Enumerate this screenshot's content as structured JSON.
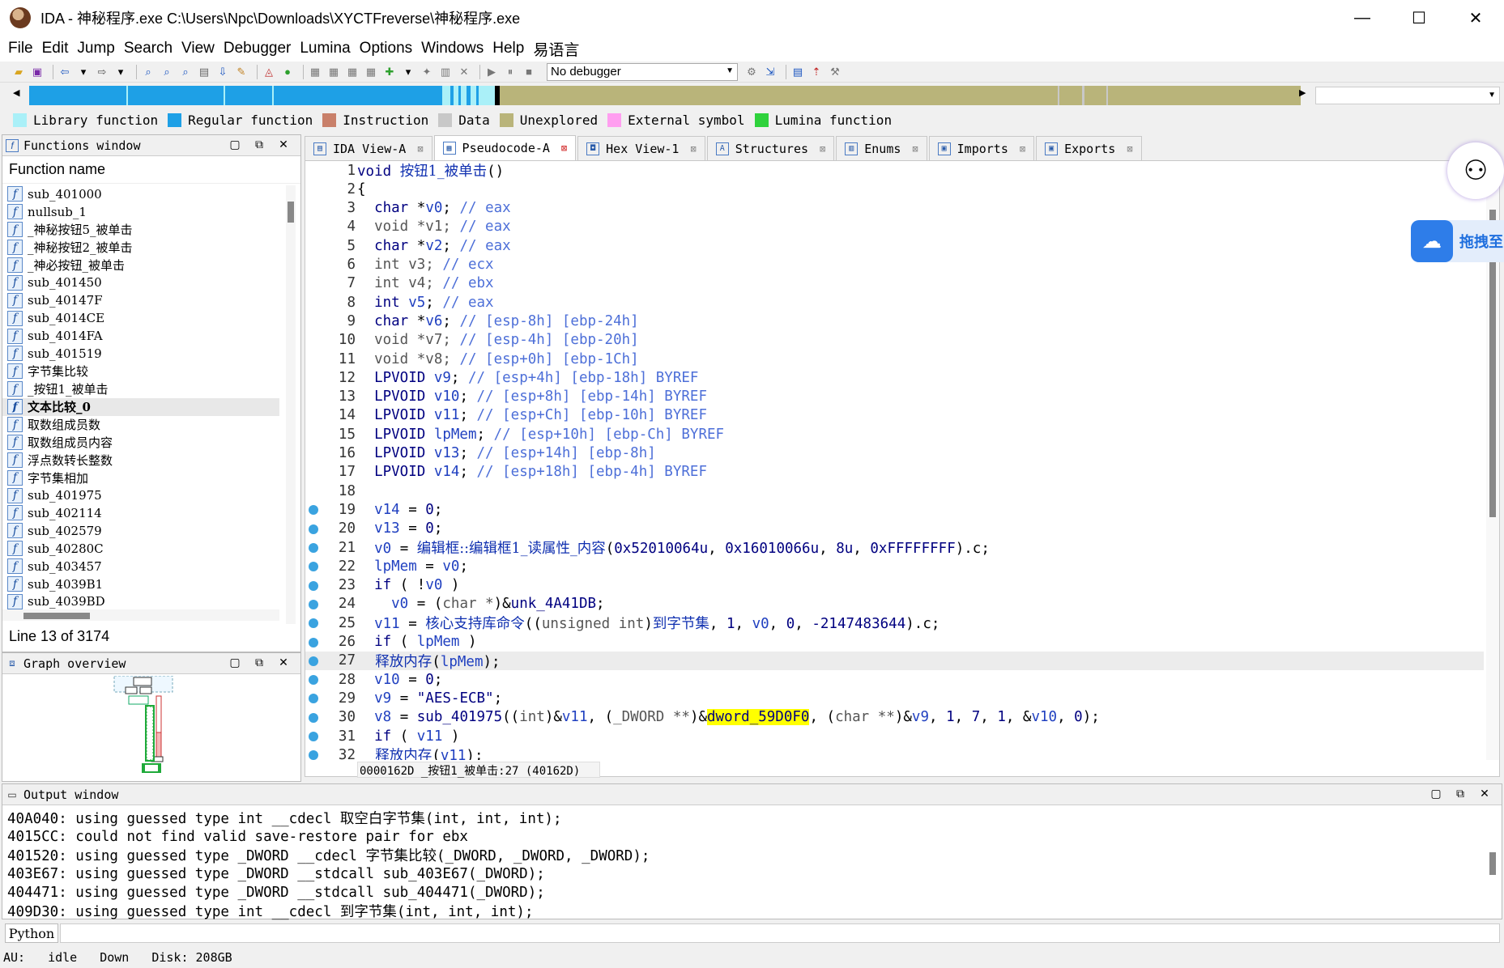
{
  "window": {
    "title": "IDA - 神秘程序.exe C:\\Users\\Npc\\Downloads\\XYCTFreverse\\神秘程序.exe",
    "minimize": "—",
    "maximize": "☐",
    "close": "✕"
  },
  "menu": [
    "File",
    "Edit",
    "Jump",
    "Search",
    "View",
    "Debugger",
    "Lumina",
    "Options",
    "Windows",
    "Help",
    "易语言"
  ],
  "toolbar": {
    "debugger_select": "No debugger"
  },
  "legend": [
    {
      "label": "Library function",
      "color": "#aaf0f8"
    },
    {
      "label": "Regular function",
      "color": "#1ea0e6"
    },
    {
      "label": "Instruction",
      "color": "#c9806a"
    },
    {
      "label": "Data",
      "color": "#c8c8c8"
    },
    {
      "label": "Unexplored",
      "color": "#b9b47a"
    },
    {
      "label": "External symbol",
      "color": "#ff9ef0"
    },
    {
      "label": "Lumina function",
      "color": "#2fd23c"
    }
  ],
  "functions_window": {
    "title": "Functions window",
    "column": "Function name",
    "status": "Line 13 of 3174",
    "items": [
      "sub_401000",
      "nullsub_1",
      "_神秘按钮5_被单击",
      "_神秘按钮2_被单击",
      "_神必按钮_被单击",
      "sub_401450",
      "sub_40147F",
      "sub_4014CE",
      "sub_4014FA",
      "sub_401519",
      "字节集比较",
      "_按钮1_被单击",
      "文本比较_0",
      "取数组成员数",
      "取数组成员内容",
      "浮点数转长整数",
      "字节集相加",
      "sub_401975",
      "sub_402114",
      "sub_402579",
      "sub_40280C",
      "sub_403457",
      "sub_4039B1",
      "sub_4039BD"
    ],
    "selected_index": 12
  },
  "graph_overview": {
    "title": "Graph overview"
  },
  "tabs": [
    {
      "label": "IDA View-A",
      "icon": "ida-view-icon",
      "active": false
    },
    {
      "label": "Pseudocode-A",
      "icon": "pseudocode-icon",
      "active": true
    },
    {
      "label": "Hex View-1",
      "icon": "hex-icon",
      "active": false
    },
    {
      "label": "Structures",
      "icon": "structures-icon",
      "active": false
    },
    {
      "label": "Enums",
      "icon": "enums-icon",
      "active": false
    },
    {
      "label": "Imports",
      "icon": "imports-icon",
      "active": false
    },
    {
      "label": "Exports",
      "icon": "exports-icon",
      "active": false
    }
  ],
  "pseudocode": {
    "status": "0000162D _按钮1_被单击:27 (40162D)",
    "highlighted_line": 27,
    "lines": [
      {
        "n": 1,
        "bp": false,
        "parts": [
          [
            "kw",
            "void "
          ],
          [
            "cn",
            "按钮1_被单击"
          ],
          [
            "pl",
            "()"
          ]
        ]
      },
      {
        "n": 2,
        "bp": false,
        "parts": [
          [
            "pl",
            "{"
          ]
        ]
      },
      {
        "n": 3,
        "bp": false,
        "parts": [
          [
            "kw",
            "  char "
          ],
          [
            "pl",
            "*"
          ],
          [
            "var",
            "v0"
          ],
          [
            "pl",
            "; "
          ],
          [
            "cm",
            "// eax"
          ]
        ]
      },
      {
        "n": 4,
        "bp": false,
        "parts": [
          [
            "dim",
            "  void *v1; "
          ],
          [
            "cm",
            "// eax"
          ]
        ]
      },
      {
        "n": 5,
        "bp": false,
        "parts": [
          [
            "kw",
            "  char "
          ],
          [
            "pl",
            "*"
          ],
          [
            "var",
            "v2"
          ],
          [
            "pl",
            "; "
          ],
          [
            "cm",
            "// eax"
          ]
        ]
      },
      {
        "n": 6,
        "bp": false,
        "parts": [
          [
            "dim",
            "  int v3; "
          ],
          [
            "cm",
            "// ecx"
          ]
        ]
      },
      {
        "n": 7,
        "bp": false,
        "parts": [
          [
            "dim",
            "  int v4; "
          ],
          [
            "cm",
            "// ebx"
          ]
        ]
      },
      {
        "n": 8,
        "bp": false,
        "parts": [
          [
            "kw",
            "  int "
          ],
          [
            "var",
            "v5"
          ],
          [
            "pl",
            "; "
          ],
          [
            "cm",
            "// eax"
          ]
        ]
      },
      {
        "n": 9,
        "bp": false,
        "parts": [
          [
            "kw",
            "  char "
          ],
          [
            "pl",
            "*"
          ],
          [
            "var",
            "v6"
          ],
          [
            "pl",
            "; "
          ],
          [
            "cm",
            "// [esp-8h] [ebp-24h]"
          ]
        ]
      },
      {
        "n": 10,
        "bp": false,
        "parts": [
          [
            "dim",
            "  void *v7; "
          ],
          [
            "cm",
            "// [esp-4h] [ebp-20h]"
          ]
        ]
      },
      {
        "n": 11,
        "bp": false,
        "parts": [
          [
            "dim",
            "  void *v8; "
          ],
          [
            "cm",
            "// [esp+0h] [ebp-1Ch]"
          ]
        ]
      },
      {
        "n": 12,
        "bp": false,
        "parts": [
          [
            "kw",
            "  LPVOID "
          ],
          [
            "var",
            "v9"
          ],
          [
            "pl",
            "; "
          ],
          [
            "cm",
            "// [esp+4h] [ebp-18h] BYREF"
          ]
        ]
      },
      {
        "n": 13,
        "bp": false,
        "parts": [
          [
            "kw",
            "  LPVOID "
          ],
          [
            "var",
            "v10"
          ],
          [
            "pl",
            "; "
          ],
          [
            "cm",
            "// [esp+8h] [ebp-14h] BYREF"
          ]
        ]
      },
      {
        "n": 14,
        "bp": false,
        "parts": [
          [
            "kw",
            "  LPVOID "
          ],
          [
            "var",
            "v11"
          ],
          [
            "pl",
            "; "
          ],
          [
            "cm",
            "// [esp+Ch] [ebp-10h] BYREF"
          ]
        ]
      },
      {
        "n": 15,
        "bp": false,
        "parts": [
          [
            "kw",
            "  LPVOID "
          ],
          [
            "var",
            "lpMem"
          ],
          [
            "pl",
            "; "
          ],
          [
            "cm",
            "// [esp+10h] [ebp-Ch] BYREF"
          ]
        ]
      },
      {
        "n": 16,
        "bp": false,
        "parts": [
          [
            "kw",
            "  LPVOID "
          ],
          [
            "var",
            "v13"
          ],
          [
            "pl",
            "; "
          ],
          [
            "cm",
            "// [esp+14h] [ebp-8h]"
          ]
        ]
      },
      {
        "n": 17,
        "bp": false,
        "parts": [
          [
            "kw",
            "  LPVOID "
          ],
          [
            "var",
            "v14"
          ],
          [
            "pl",
            "; "
          ],
          [
            "cm",
            "// [esp+18h] [ebp-4h] BYREF"
          ]
        ]
      },
      {
        "n": 18,
        "bp": false,
        "parts": []
      },
      {
        "n": 19,
        "bp": true,
        "parts": [
          [
            "var",
            "  v14"
          ],
          [
            "pl",
            " = "
          ],
          [
            "num",
            "0"
          ],
          [
            "pl",
            ";"
          ]
        ]
      },
      {
        "n": 20,
        "bp": true,
        "parts": [
          [
            "var",
            "  v13"
          ],
          [
            "pl",
            " = "
          ],
          [
            "num",
            "0"
          ],
          [
            "pl",
            ";"
          ]
        ]
      },
      {
        "n": 21,
        "bp": true,
        "parts": [
          [
            "var",
            "  v0"
          ],
          [
            "pl",
            " = "
          ],
          [
            "cn",
            "编辑框::编辑框1_读属性_内容"
          ],
          [
            "pl",
            "("
          ],
          [
            "num",
            "0x52010064u"
          ],
          [
            "pl",
            ", "
          ],
          [
            "num",
            "0x16010066u"
          ],
          [
            "pl",
            ", "
          ],
          [
            "num",
            "8u"
          ],
          [
            "pl",
            ", "
          ],
          [
            "num",
            "0xFFFFFFFF"
          ],
          [
            "pl",
            ").c;"
          ]
        ]
      },
      {
        "n": 22,
        "bp": true,
        "parts": [
          [
            "var",
            "  lpMem"
          ],
          [
            "pl",
            " = "
          ],
          [
            "var",
            "v0"
          ],
          [
            "pl",
            ";"
          ]
        ]
      },
      {
        "n": 23,
        "bp": true,
        "parts": [
          [
            "kw",
            "  if"
          ],
          [
            "pl",
            " ( !"
          ],
          [
            "var",
            "v0"
          ],
          [
            "pl",
            " )"
          ]
        ]
      },
      {
        "n": 24,
        "bp": true,
        "parts": [
          [
            "var",
            "    v0"
          ],
          [
            "pl",
            " = ("
          ],
          [
            "dim",
            "char *"
          ],
          [
            "pl",
            ")&"
          ],
          [
            "kw",
            "unk_4A41DB"
          ],
          [
            "pl",
            ";"
          ]
        ]
      },
      {
        "n": 25,
        "bp": true,
        "parts": [
          [
            "var",
            "  v11"
          ],
          [
            "pl",
            " = "
          ],
          [
            "cn",
            "核心支持库命令"
          ],
          [
            "pl",
            "(("
          ],
          [
            "dim",
            "unsigned int"
          ],
          [
            "pl",
            ")"
          ],
          [
            "cn",
            "到字节集"
          ],
          [
            "pl",
            ", "
          ],
          [
            "num",
            "1"
          ],
          [
            "pl",
            ", "
          ],
          [
            "var",
            "v0"
          ],
          [
            "pl",
            ", "
          ],
          [
            "num",
            "0"
          ],
          [
            "pl",
            ", "
          ],
          [
            "num",
            "-2147483644"
          ],
          [
            "pl",
            ").c;"
          ]
        ]
      },
      {
        "n": 26,
        "bp": true,
        "parts": [
          [
            "kw",
            "  if"
          ],
          [
            "pl",
            " ( "
          ],
          [
            "var",
            "lpMem"
          ],
          [
            "pl",
            " )"
          ]
        ]
      },
      {
        "n": 27,
        "bp": true,
        "parts": [
          [
            "cn",
            "    释放内存"
          ],
          [
            "pl",
            "("
          ],
          [
            "var",
            "lpMem"
          ],
          [
            "pl",
            ");"
          ]
        ]
      },
      {
        "n": 28,
        "bp": true,
        "parts": [
          [
            "var",
            "  v10"
          ],
          [
            "pl",
            " = "
          ],
          [
            "num",
            "0"
          ],
          [
            "pl",
            ";"
          ]
        ]
      },
      {
        "n": 29,
        "bp": true,
        "parts": [
          [
            "var",
            "  v9"
          ],
          [
            "pl",
            " = "
          ],
          [
            "str",
            "\"AES-ECB\""
          ],
          [
            "pl",
            ";"
          ]
        ]
      },
      {
        "n": 30,
        "bp": true,
        "parts": [
          [
            "var",
            "  v8"
          ],
          [
            "pl",
            " = "
          ],
          [
            "kw",
            "sub_401975"
          ],
          [
            "pl",
            "(("
          ],
          [
            "dim",
            "int"
          ],
          [
            "pl",
            ")&"
          ],
          [
            "var",
            "v11"
          ],
          [
            "pl",
            ", ("
          ],
          [
            "dim",
            "_DWORD **"
          ],
          [
            "pl",
            ")&"
          ],
          [
            "yel",
            "dword_59D0F0"
          ],
          [
            "pl",
            ", ("
          ],
          [
            "dim",
            "char **"
          ],
          [
            "pl",
            ")&"
          ],
          [
            "var",
            "v9"
          ],
          [
            "pl",
            ", "
          ],
          [
            "num",
            "1"
          ],
          [
            "pl",
            ", "
          ],
          [
            "num",
            "7"
          ],
          [
            "pl",
            ", "
          ],
          [
            "num",
            "1"
          ],
          [
            "pl",
            ", &"
          ],
          [
            "var",
            "v10"
          ],
          [
            "pl",
            ", "
          ],
          [
            "num",
            "0"
          ],
          [
            "pl",
            ");"
          ]
        ]
      },
      {
        "n": 31,
        "bp": true,
        "parts": [
          [
            "kw",
            "  if"
          ],
          [
            "pl",
            " ( "
          ],
          [
            "var",
            "v11"
          ],
          [
            "pl",
            " )"
          ]
        ]
      },
      {
        "n": 32,
        "bp": true,
        "parts": [
          [
            "cn",
            "    释放内存"
          ],
          [
            "pl",
            "("
          ],
          [
            "var",
            "v11"
          ],
          [
            "pl",
            ");"
          ]
        ]
      }
    ]
  },
  "output_window": {
    "title": "Output window",
    "lines": [
      "40A040: using guessed type int __cdecl 取空白字节集(int, int, int);",
      "4015CC: could not find valid save-restore pair for ebx",
      "401520: using guessed type _DWORD __cdecl 字节集比较(_DWORD, _DWORD, _DWORD);",
      "403E67: using guessed type _DWORD __stdcall sub_403E67(_DWORD);",
      "404471: using guessed type _DWORD __stdcall sub_404471(_DWORD);",
      "409D30: using guessed type int __cdecl 到字节集(int, int, int);"
    ]
  },
  "python_button": "Python",
  "statusbar": {
    "au": "AU:",
    "state": "idle",
    "direction": "Down",
    "disk": "Disk: 208GB"
  },
  "floating": {
    "pill_text": "拖拽至"
  }
}
